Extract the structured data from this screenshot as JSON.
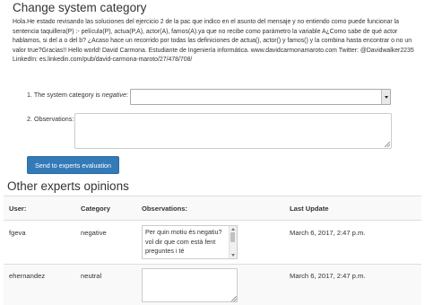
{
  "page": {
    "title": "Change system category",
    "message": "Hola.He estado revisando las soluciones del ejercicio 2 de la pac que indico en el asunto del mensaje y no entiendo como puede funcionar la sentencia taquillera(P) :- película(P), actua(P,A), actor(A), famos(A).ya que no recibe como parámetro la variable A¿Como sabe de qué actor hablamos, si del a o del b? ¿Acaso hace un recorrido por todas las definiciones de actua(), actor() y famos() y la combina hasta encontrar o no un valor true?Gracias!! Hello world! David Carmona. Estudiante de Ingeniería informática. www.davidcarmonamaroto.com Twitter: @Davidwalker2235 LinkedIn: es.linkedin.com/pub/david-carmona-maroto/27/478/708/"
  },
  "form": {
    "category_label_prefix": "1. The system category is ",
    "category_label_emphasis": "negative",
    "category_label_suffix": ":",
    "category_value": "",
    "observations_label": "2. Observations:",
    "observations_value": "",
    "submit_label": "Send to experts evaluation"
  },
  "experts": {
    "title": "Other experts opinions",
    "columns": {
      "user": "User:",
      "category": "Category",
      "observations": "Observations:",
      "last_update": "Last Update"
    },
    "rows": [
      {
        "user": "fgeva",
        "category": "negative",
        "observations": "Per quin motiu és negatiu? vol dir que com està fent preguntes i té",
        "last_update": "March 6, 2017, 2:47 p.m."
      },
      {
        "user": "ehernandez",
        "category": "neutral",
        "observations": "",
        "last_update": "March 6, 2017, 2:47 p.m."
      }
    ]
  },
  "colors": {
    "primary_button": "#337ab7",
    "table_stripe": "#f9f9f9",
    "border": "#dddddd",
    "text": "#333333"
  },
  "icons": {
    "select_arrow": "chevron-down-icon",
    "textarea_resize": "resize-grip-icon"
  }
}
